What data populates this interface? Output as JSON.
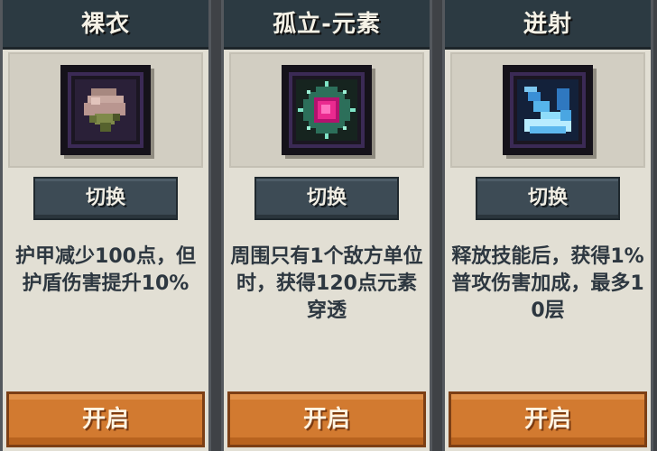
{
  "cards": [
    {
      "title": "裸衣",
      "icon": "pink-flower-sack-icon",
      "toggle_label": "切换",
      "description": "护甲减少100点，但护盾伤害提升10%",
      "action_label": "开启"
    },
    {
      "title": "孤立-元素",
      "icon": "magenta-element-orb-icon",
      "toggle_label": "切换",
      "description": "周围只有1个敌方单位时，获得120点元素穿透",
      "action_label": "开启"
    },
    {
      "title": "迸射",
      "icon": "blue-crystal-burst-icon",
      "toggle_label": "切换",
      "description": "释放技能后，获得1%普攻伤害加成，最多10层",
      "action_label": "开启"
    }
  ],
  "colors": {
    "card_bg": "#e2dfd4",
    "title_bar": "#2c3a42",
    "toggle_button": "#3d4b55",
    "open_button": "#d27a30",
    "text": "#2d3740"
  }
}
